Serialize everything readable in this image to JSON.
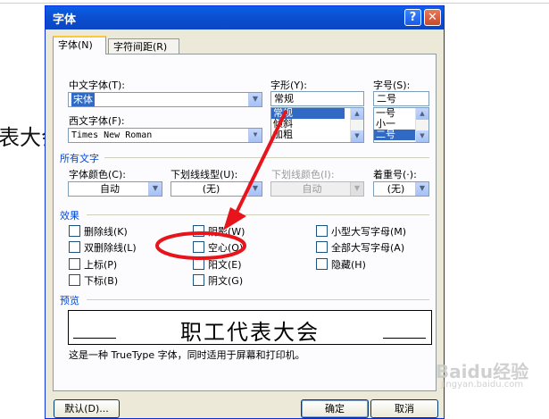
{
  "background": {
    "text": "表大会"
  },
  "dialog": {
    "title": "字体",
    "help_label": "?",
    "close_label": "✕",
    "tabs": [
      {
        "label": "字体(N)"
      },
      {
        "label": "字符间距(R)"
      }
    ],
    "chinese_font": {
      "label": "中文字体(T):",
      "value": "宋体"
    },
    "western_font": {
      "label": "西文字体(F):",
      "value": "Times New Roman"
    },
    "font_style": {
      "label": "字形(Y):",
      "value": "常规",
      "options": [
        "常规",
        "倾斜",
        "加粗"
      ],
      "selected": "常规"
    },
    "font_size": {
      "label": "字号(S):",
      "value": "二号",
      "options": [
        "一号",
        "小一",
        "二号"
      ],
      "selected": "二号"
    },
    "all_text": {
      "section_label": "所有文字",
      "font_color": {
        "label": "字体颜色(C):",
        "value": "自动"
      },
      "underline_type": {
        "label": "下划线线型(U):",
        "value": "(无)"
      },
      "underline_color": {
        "label": "下划线颜色(I):",
        "value": "自动"
      },
      "emphasis": {
        "label": "着重号(·):",
        "value": "(无)"
      }
    },
    "effects": {
      "section_label": "效果",
      "options": [
        {
          "label": "删除线(K)",
          "checked": false
        },
        {
          "label": "双删除线(L)",
          "checked": false
        },
        {
          "label": "上标(P)",
          "checked": false
        },
        {
          "label": "下标(B)",
          "checked": false
        },
        {
          "label": "阴影(W)",
          "checked": false
        },
        {
          "label": "空心(O)",
          "checked": false
        },
        {
          "label": "阳文(E)",
          "checked": false
        },
        {
          "label": "阴文(G)",
          "checked": false
        },
        {
          "label": "小型大写字母(M)",
          "checked": false
        },
        {
          "label": "全部大写字母(A)",
          "checked": false
        },
        {
          "label": "隐藏(H)",
          "checked": false
        }
      ]
    },
    "preview": {
      "section_label": "预览",
      "text": "职工代表大会",
      "description": "这是一种 TrueType 字体，同时适用于屏幕和打印机。"
    },
    "buttons": {
      "default_label": "默认(D)...",
      "ok_label": "确定",
      "cancel_label": "取消"
    }
  },
  "annotation": {
    "color": "#e8141b"
  },
  "watermark": {
    "text": "Baidu经验",
    "url": "jingyan.baidu.com"
  }
}
